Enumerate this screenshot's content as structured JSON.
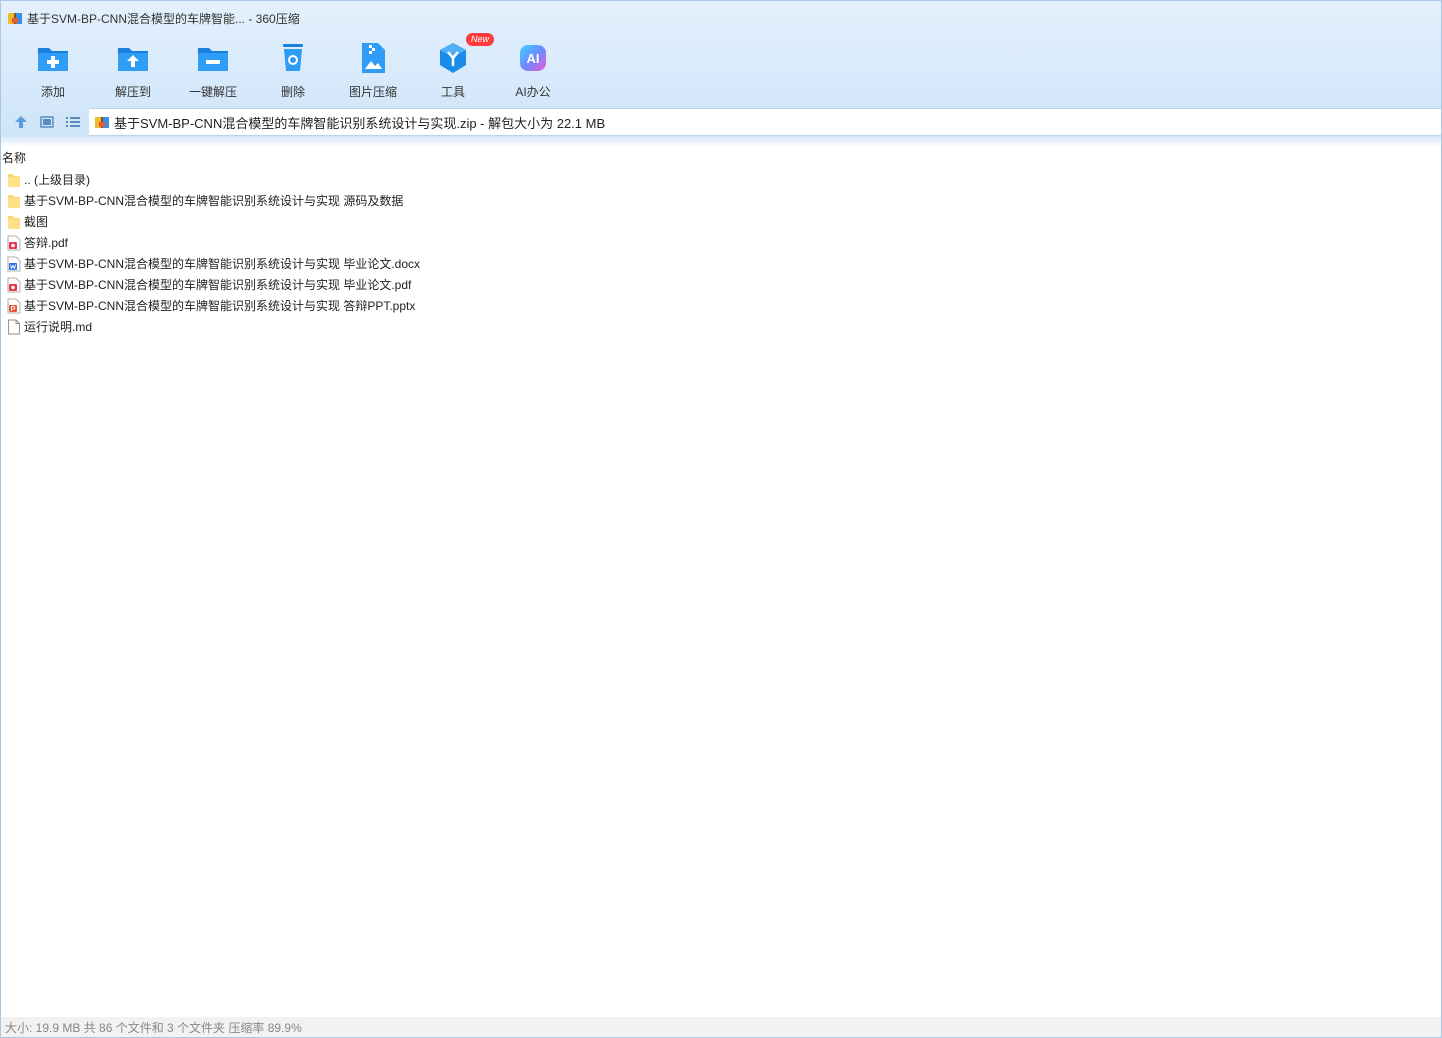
{
  "window": {
    "title": "基于SVM-BP-CNN混合模型的车牌智能... - 360压缩"
  },
  "toolbar": {
    "items": [
      {
        "label": "添加",
        "icon": "add-folder-icon"
      },
      {
        "label": "解压到",
        "icon": "extract-to-icon"
      },
      {
        "label": "一键解压",
        "icon": "one-click-extract-icon"
      },
      {
        "label": "删除",
        "icon": "trash-icon"
      },
      {
        "label": "图片压缩",
        "icon": "image-compress-icon"
      },
      {
        "label": "工具",
        "icon": "tools-cube-icon",
        "badge": "New"
      },
      {
        "label": "AI办公",
        "icon": "ai-office-icon"
      }
    ]
  },
  "nav": {
    "path": "基于SVM-BP-CNN混合模型的车牌智能识别系统设计与实现.zip - 解包大小为 22.1 MB"
  },
  "list": {
    "column_name": "名称",
    "rows": [
      {
        "name": ".. (上级目录)",
        "type": "folder"
      },
      {
        "name": "基于SVM-BP-CNN混合模型的车牌智能识别系统设计与实现 源码及数据",
        "type": "folder"
      },
      {
        "name": "截图",
        "type": "folder"
      },
      {
        "name": "答辩.pdf",
        "type": "pdf"
      },
      {
        "name": "基于SVM-BP-CNN混合模型的车牌智能识别系统设计与实现 毕业论文.docx",
        "type": "docx"
      },
      {
        "name": "基于SVM-BP-CNN混合模型的车牌智能识别系统设计与实现 毕业论文.pdf",
        "type": "pdf"
      },
      {
        "name": "基于SVM-BP-CNN混合模型的车牌智能识别系统设计与实现 答辩PPT.pptx",
        "type": "pptx"
      },
      {
        "name": "运行说明.md",
        "type": "md"
      }
    ]
  },
  "status": {
    "text": "大小: 19.9 MB 共 86 个文件和 3 个文件夹 压缩率 89.9%"
  },
  "colors": {
    "accent": "#1e8ef0",
    "folder": "#ffd86b",
    "pdf": "#e8364a",
    "docx": "#2f6fe0",
    "pptx": "#e8533a"
  }
}
